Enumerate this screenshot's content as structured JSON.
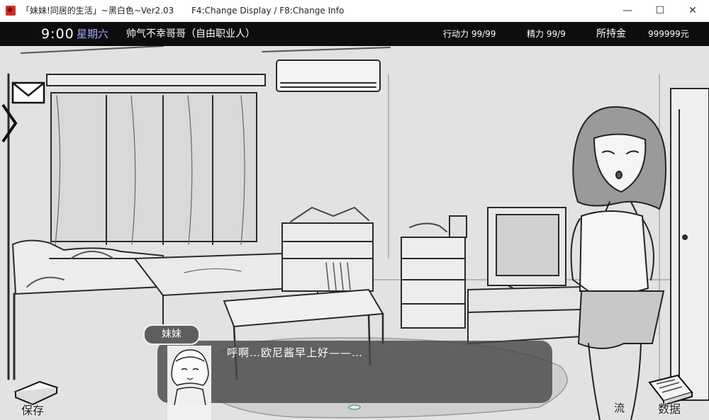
{
  "window": {
    "title": "「妹妹!同居的生活」~黑白色~Ver2.03",
    "hint": "F4:Change Display / F8:Change Info",
    "minimize": "—",
    "maximize": "☐",
    "close": "✕"
  },
  "status": {
    "time": "9:00",
    "day": "星期六",
    "player": "帅气不幸哥哥（自由职业人）",
    "action_points": "行动力 99/99",
    "energy": "精力 99/9",
    "gold_label": "所持金",
    "gold": "999999元"
  },
  "dialogue": {
    "speaker": "妹妹",
    "text": "呼啊…欧尼酱早上好——…"
  },
  "menu": {
    "save": "保存",
    "chat": "流",
    "data": "数据"
  },
  "icons": {
    "mail": "envelope-icon",
    "side": "side-arrow-icon",
    "next": "next-indicator-icon"
  }
}
